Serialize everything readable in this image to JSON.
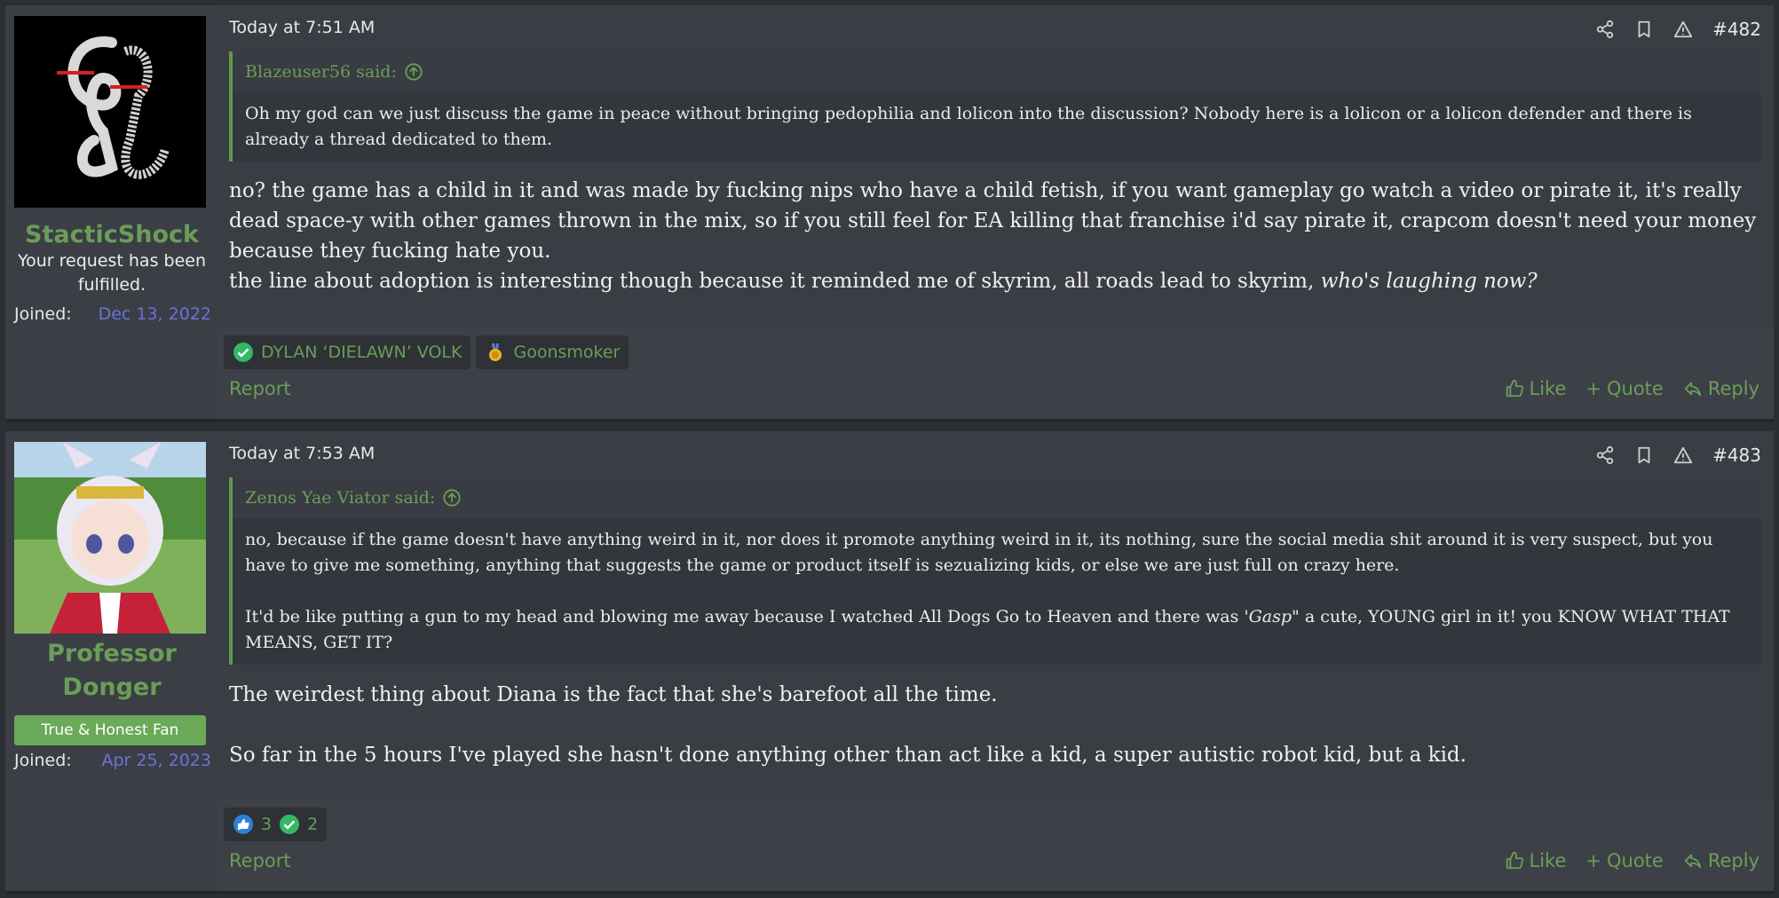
{
  "posts": [
    {
      "username": "StacticShock",
      "user_title": "Your request has been fulfilled.",
      "joined_label": "Joined:",
      "joined_date": "Dec 13, 2022",
      "timestamp": "Today at 7:51 AM",
      "post_number": "#482",
      "quote_author": "Blazeuser56 said:",
      "quote_text": "Oh my god can we just discuss the game in peace without bringing pedophilia and lolicon into the discussion? Nobody here is a lolicon or a lolicon defender and there is already a thread dedicated to them.",
      "message_1": "no? the game has a child in it and was made by fucking nips who have a child fetish, if you want gameplay go watch a video or pirate it, it's really dead space-y with other games thrown in the mix, so if you still feel for EA killing that franchise i'd say pirate it, crapcom doesn't need your money because they fucking hate you.",
      "message_2": "the line about adoption is interesting though because it reminded me of skyrim, all roads lead to skyrim,",
      "message_2_italic": "who's laughing now?",
      "trophies": [
        {
          "icon": "check-circle-icon",
          "label": "DYLAN ‘DIELAWN’ VOLK"
        },
        {
          "icon": "medal-icon",
          "label": "Goonsmoker"
        }
      ],
      "report_label": "Report",
      "like_label": "Like",
      "quote_label": "Quote",
      "reply_label": "Reply"
    },
    {
      "username_line1": "Professor",
      "username_line2": "Donger",
      "user_banner": "True & Honest Fan",
      "joined_label": "Joined:",
      "joined_date": "Apr 25, 2023",
      "timestamp": "Today at 7:53 AM",
      "post_number": "#483",
      "quote_author": "Zenos Yae Viator said:",
      "quote_text_1": "no, because if the game doesn't have anything weird in it, nor does it promote anything weird in it, its nothing, sure the social media shit around it is very suspect, but you have to give me something, anything that suggests the game or product itself is sezualizing kids, or else we are just full on crazy here.",
      "quote_text_2a": "It'd be like putting a gun to my head and blowing me away because I watched All Dogs Go to Heaven and there was '",
      "quote_text_2_italic": "Gasp\"",
      "quote_text_2b": " a cute, YOUNG girl in it! you KNOW WHAT THAT MEANS, GET IT?",
      "message_1": "The weirdest thing about Diana is the fact that she's barefoot all the time.",
      "message_2": "So far in the 5 hours I've played she hasn't done anything other than act like a kid, a super autistic robot kid, but a kid.",
      "reactions": [
        {
          "icon": "thumbs-up-reaction-icon",
          "count": "3"
        },
        {
          "icon": "check-reaction-icon",
          "count": "2"
        }
      ],
      "report_label": "Report",
      "like_label": "Like",
      "quote_label": "Quote",
      "reply_label": "Reply"
    }
  ],
  "colors": {
    "accent_green": "#6a9e58",
    "date_blue": "#6a72d6",
    "post_bg": "#3a3d44"
  }
}
